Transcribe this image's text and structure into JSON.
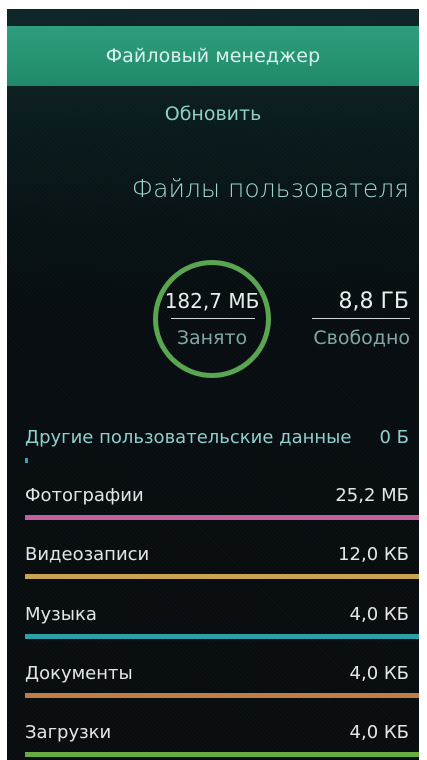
{
  "pulley_menu": {
    "title": "Файловый менеджер",
    "refresh": "Обновить"
  },
  "page_title": "Файлы пользователя",
  "storage": {
    "used_value": "182,7 МБ",
    "used_label": "Занято",
    "free_value": "8,8 ГБ",
    "free_label": "Свободно",
    "ring_color": "#59a551"
  },
  "categories": [
    {
      "name": "Другие пользовательские данные",
      "size": "0 Б",
      "color": "#3b9fb8",
      "fraction": 0.0
    },
    {
      "name": "Фотографии",
      "size": "25,2 МБ",
      "color": "#c5609e",
      "fraction": 1.0
    },
    {
      "name": "Видеозаписи",
      "size": "12,0 КБ",
      "color": "#c9a454",
      "fraction": 1.0
    },
    {
      "name": "Музыка",
      "size": "4,0 КБ",
      "color": "#2aa1a9",
      "fraction": 1.0
    },
    {
      "name": "Документы",
      "size": "4,0 КБ",
      "color": "#c07d4c",
      "fraction": 1.0
    },
    {
      "name": "Загрузки",
      "size": "4,0 КБ",
      "color": "#69ad3f",
      "fraction": 1.0
    }
  ]
}
